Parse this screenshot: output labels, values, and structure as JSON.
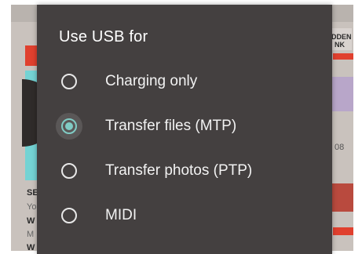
{
  "dialog": {
    "title": "Use USB for",
    "selected_index": 1,
    "options": [
      {
        "label": "Charging only",
        "checked": false
      },
      {
        "label": "Transfer files (MTP)",
        "checked": true
      },
      {
        "label": "Transfer photos (PTP)",
        "checked": false
      },
      {
        "label": "MIDI",
        "checked": false
      }
    ]
  },
  "background": {
    "left_snippets": [
      "SE",
      "Yo",
      "W",
      "M",
      "W"
    ],
    "right_snippets": [
      "DDEN",
      "NK",
      "08"
    ]
  },
  "colors": {
    "dialog_bg": "#444040",
    "accent": "#80cbc4",
    "text": "#f2f2f2"
  }
}
